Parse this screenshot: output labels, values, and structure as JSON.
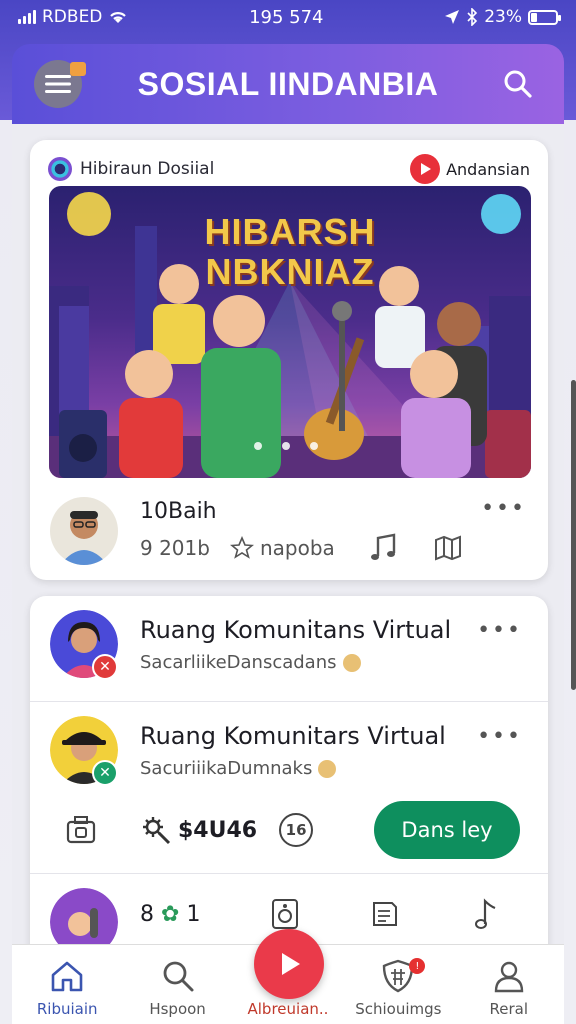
{
  "status_bar": {
    "carrier": "RDBED",
    "time": "195 574",
    "battery_percent": "23%",
    "battery_level": 0.23
  },
  "header": {
    "title": "SOSIAL IINDANBIA"
  },
  "post": {
    "source_name": "Hibiraun Dosiial",
    "badge_label": "Andansian",
    "banner_title_line1": "HIBARSH",
    "banner_title_line2": "NBKNIAZ",
    "author": "10Baih",
    "stat": "9 201b",
    "tag": "napoba"
  },
  "list": {
    "items": [
      {
        "title": "Ruang Komunitans Virtual",
        "subtitle": "SacarliikeDanscadans",
        "badge_color": "#e03a3a"
      },
      {
        "title": "Ruang Komunitars Virtual",
        "subtitle": "SacuriiikaDumnaks",
        "badge_color": "#1aa06a",
        "price": "$4U46",
        "circle_text": "16",
        "action_button": "Dans ley"
      },
      {
        "title": "8",
        "title_suffix": "1"
      }
    ]
  },
  "bottom_nav": {
    "items": [
      {
        "label": "Ribuiain"
      },
      {
        "label": "Hspoon"
      },
      {
        "label": "Albreuian.."
      },
      {
        "label": "Schiouimgs"
      },
      {
        "label": "Reral"
      }
    ]
  },
  "colors": {
    "header_start": "#5a4fd8",
    "header_end": "#9a63e2",
    "fab": "#ea3a4a",
    "action_button": "#0e8f5e"
  }
}
